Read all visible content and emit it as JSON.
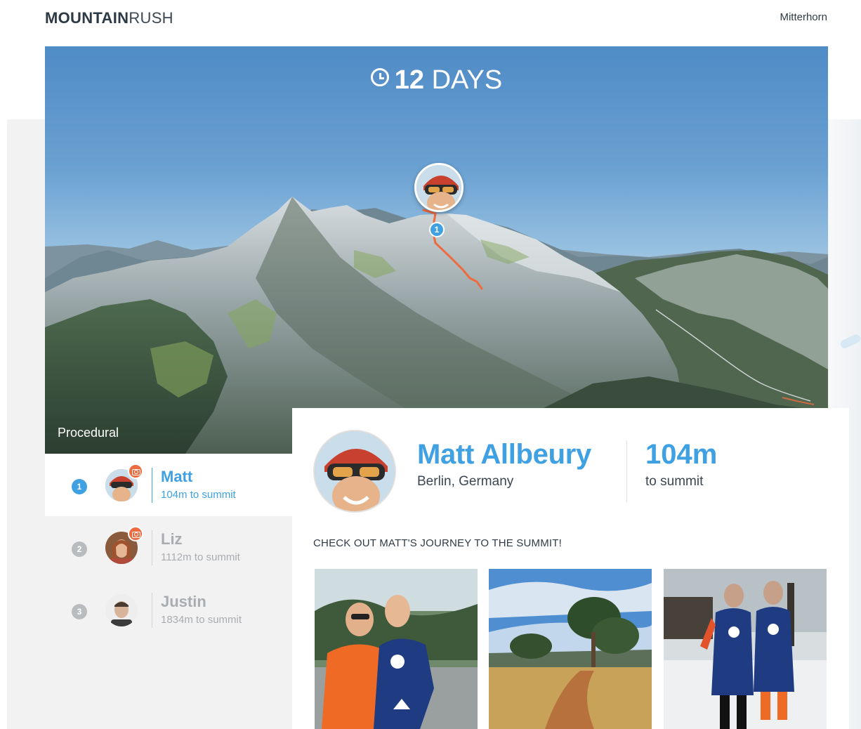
{
  "brand": {
    "bold": "MOUNTAIN",
    "light": "RUSH"
  },
  "nav": {
    "mountain_link": "Mitterhorn"
  },
  "hero": {
    "countdown_number": "12",
    "countdown_unit": "DAYS",
    "pin_rank": "1",
    "render_mode": "Procedural"
  },
  "leaderboard": [
    {
      "rank": "1",
      "name": "Matt",
      "distance": "104m to summit",
      "has_photos": true
    },
    {
      "rank": "2",
      "name": "Liz",
      "distance": "1112m to summit",
      "has_photos": true
    },
    {
      "rank": "3",
      "name": "Justin",
      "distance": "1834m to summit",
      "has_photos": false
    }
  ],
  "profile": {
    "name": "Matt Allbeury",
    "location": "Berlin, Germany",
    "stat_value": "104m",
    "stat_label": "to summit",
    "journey_heading": "CHECK OUT MATT'S JOURNEY TO THE SUMMIT!"
  },
  "colors": {
    "accent": "#3fa0e2",
    "route": "#ee6b3f",
    "muted": "#a9adb1"
  },
  "icons": [
    "clock-icon",
    "camera-icon"
  ]
}
